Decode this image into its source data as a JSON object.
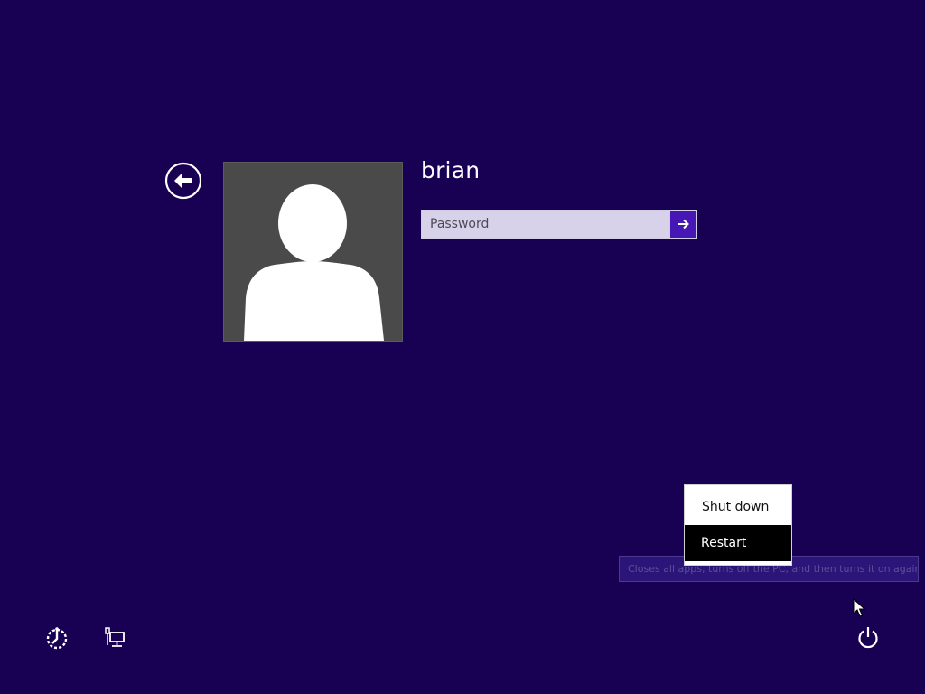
{
  "user": {
    "name": "brian"
  },
  "password": {
    "placeholder": "Password",
    "value": ""
  },
  "power_menu": {
    "items": [
      {
        "label": "Shut down",
        "selected": false
      },
      {
        "label": "Restart",
        "selected": true
      }
    ]
  },
  "tooltip": {
    "text": "Closes all apps, turns off the PC, and then turns it on again."
  },
  "icons": {
    "back": "back-arrow-icon",
    "submit": "arrow-right-icon",
    "ease_of_access": "ease-of-access-icon",
    "network": "network-icon",
    "power": "power-icon",
    "cursor": "mouse-cursor-icon"
  },
  "colors": {
    "background": "#180052",
    "submit_button": "#4617b4",
    "avatar_background": "#4a4a4a",
    "input_background": "#d8d1ea"
  }
}
